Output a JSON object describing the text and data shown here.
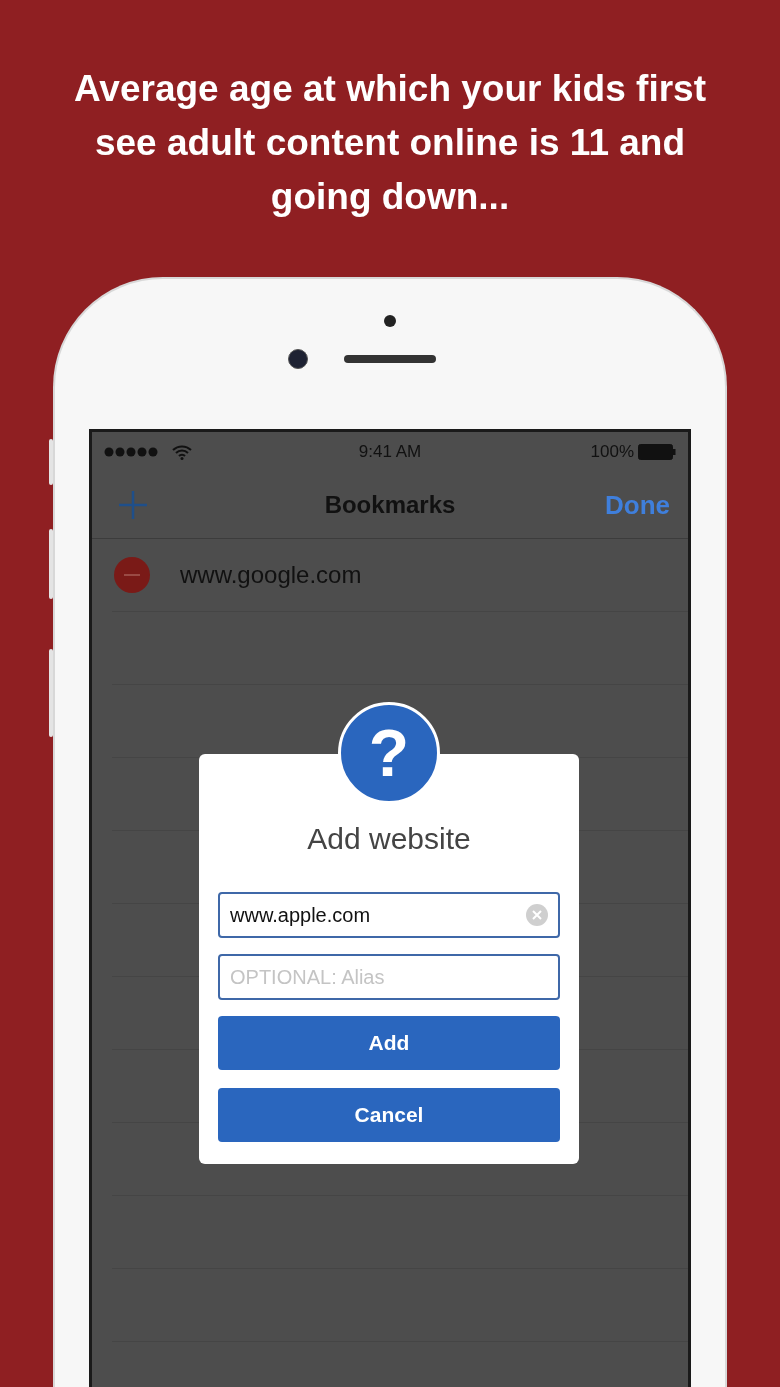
{
  "headline": "Average age at which your kids first see adult content online is 11 and going down...",
  "status_bar": {
    "time": "9:41 AM",
    "battery": "100%"
  },
  "nav_bar": {
    "title": "Bookmarks",
    "done": "Done"
  },
  "bookmarks": [
    {
      "url": "www.google.com"
    }
  ],
  "dialog": {
    "badge": "?",
    "title": "Add website",
    "url_field": {
      "value": "www.apple.com"
    },
    "alias_field": {
      "placeholder": "OPTIONAL: Alias"
    },
    "buttons": [
      "Add",
      "Cancel"
    ]
  }
}
